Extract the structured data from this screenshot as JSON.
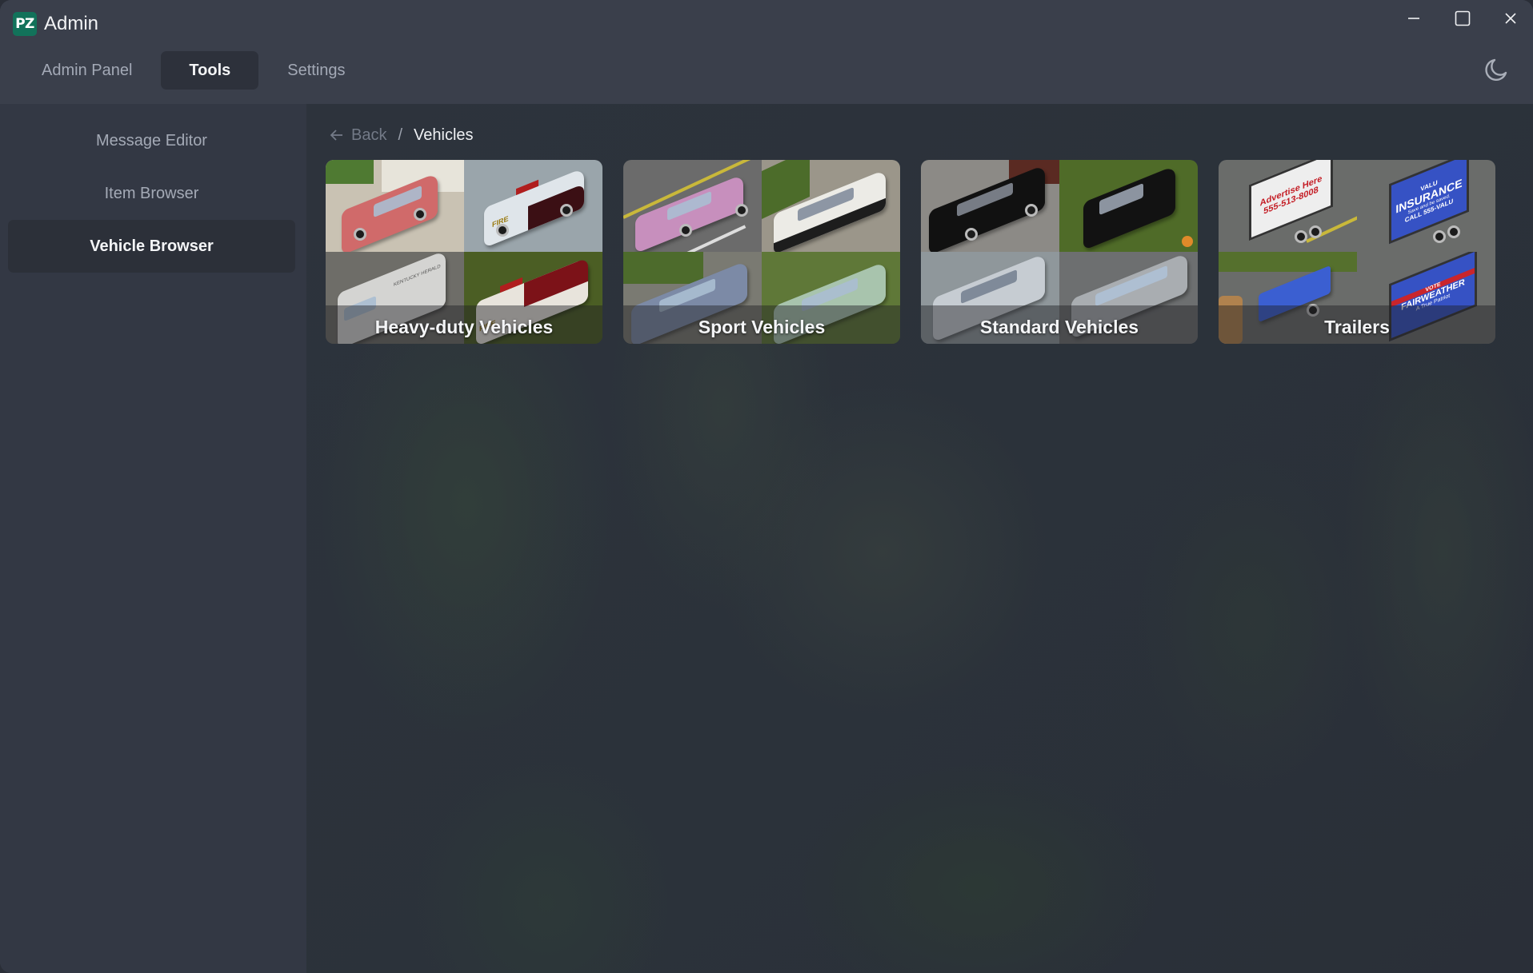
{
  "app": {
    "logo_text": "PZ",
    "title": "Admin",
    "logo_color": "#12725a"
  },
  "window_controls": {
    "minimize": "minimize-icon",
    "maximize": "maximize-icon",
    "close": "close-icon"
  },
  "tabs": [
    {
      "label": "Admin Panel",
      "active": false
    },
    {
      "label": "Tools",
      "active": true
    },
    {
      "label": "Settings",
      "active": false
    }
  ],
  "theme_toggle": {
    "icon": "moon-icon"
  },
  "sidebar": {
    "items": [
      {
        "label": "Message Editor",
        "active": false
      },
      {
        "label": "Item Browser",
        "active": false
      },
      {
        "label": "Vehicle Browser",
        "active": true
      }
    ]
  },
  "breadcrumb": {
    "back_label": "Back",
    "separator": "/",
    "current": "Vehicles"
  },
  "categories": [
    {
      "label": "Heavy-duty Vehicles"
    },
    {
      "label": "Sport Vehicles"
    },
    {
      "label": "Standard Vehicles"
    },
    {
      "label": "Trailers"
    }
  ],
  "trailer_signs": {
    "advertise": [
      "Advertise Here",
      "555-513-8008"
    ],
    "insurance": [
      "VALU",
      "INSURANCE",
      "Save and be saved.",
      "CALL 555-VALU"
    ],
    "vote": [
      "VOTE",
      "FAIRWEATHER",
      "A True Patriot"
    ]
  },
  "vehicle_decals": {
    "fire": "FIRE",
    "van_text": "KENTUCKY HERALD"
  }
}
